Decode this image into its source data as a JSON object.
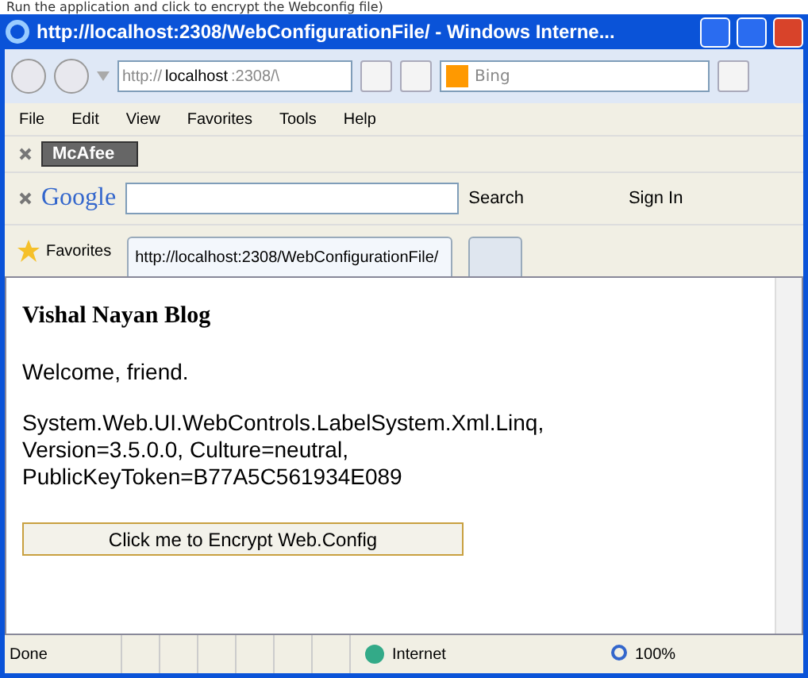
{
  "caption": "Run the application and click to encrypt the Webconfig file)",
  "window": {
    "title": "http://localhost:2308/WebConfigurationFile/ - Windows Interne..."
  },
  "address": {
    "prefix": "http://",
    "host": "localhost",
    ":port": ":2308/\\"
  },
  "search": {
    "placeholder": "Bing"
  },
  "menu": [
    "File",
    "Edit",
    "View",
    "Favorites",
    "Tools",
    "Help"
  ],
  "mcafee": {
    "label": "McAfee"
  },
  "google": {
    "logo": "Google",
    "search_label": "Search",
    "sign_in": "Sign In"
  },
  "favorites": {
    "label": "Favorites"
  },
  "tabs": [
    {
      "label": "http://localhost:2308/WebConfigurationFile/",
      "selected": true
    },
    {
      "selected": false
    }
  ],
  "page": {
    "heading": "Vishal Nayan Blog",
    "welcome": "Welcome, friend.",
    "info": "System.Web.UI.WebControls.LabelSystem.Xml.Linq, Version=3.5.0.0, Culture=neutral, PublicKeyToken=B77A5C561934E089",
    "button": "Click me to Encrypt Web.Config"
  },
  "status": {
    "text": "Done",
    "zone": "Internet",
    "zoom": "100%"
  }
}
